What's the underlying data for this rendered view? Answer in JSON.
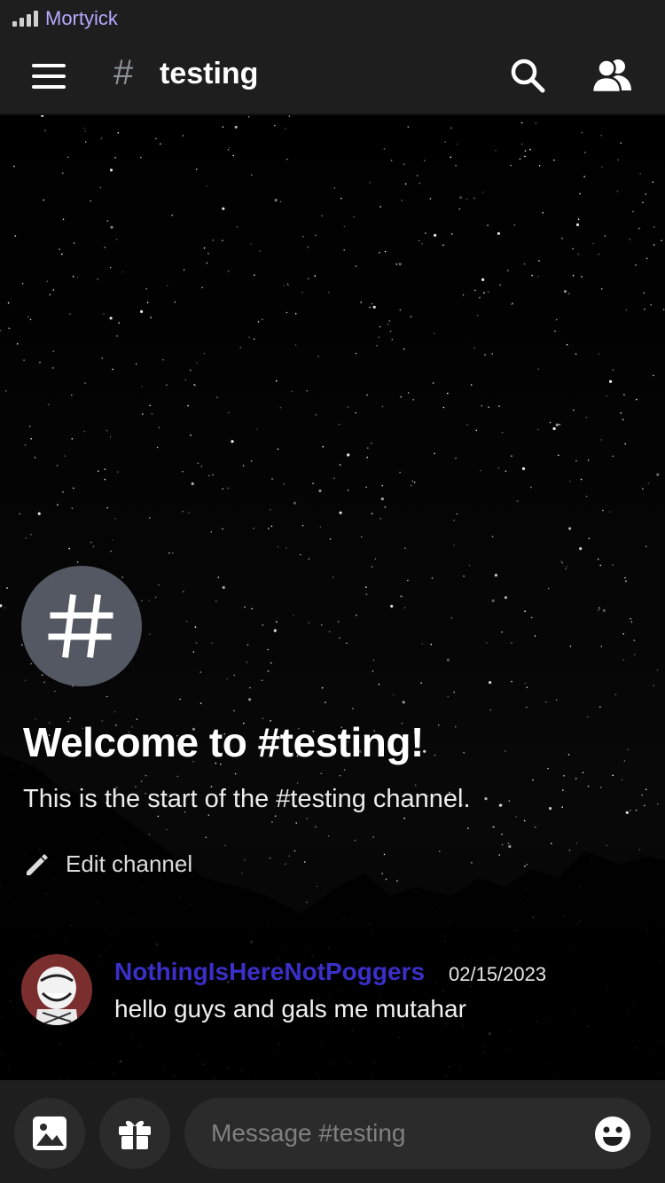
{
  "status_bar": {
    "carrier": "Mortyick",
    "signal_bars": 4
  },
  "header": {
    "channel_name": "testing",
    "icons": [
      "menu-icon",
      "hash-icon",
      "search-icon",
      "members-icon"
    ]
  },
  "welcome": {
    "title": "Welcome to #testing!",
    "subtitle": "This is the start of the #testing channel.",
    "edit_label": "Edit channel",
    "icons": [
      "hash-icon",
      "pencil-icon"
    ]
  },
  "messages": [
    {
      "author": "NothingIsHereNotPoggers",
      "timestamp": "02/15/2023",
      "text": "hello guys and gals me mutahar",
      "author_color": "#3a2fc8"
    }
  ],
  "composer": {
    "placeholder": "Message #testing",
    "icons": [
      "image-icon",
      "gift-icon",
      "emoji-icon"
    ]
  },
  "colors": {
    "background": "#000000",
    "header_bg": "#1e1e1e",
    "input_bg": "#2b2b2b",
    "carrier": "#b6a9ff",
    "channel_avatar": "#535862"
  }
}
